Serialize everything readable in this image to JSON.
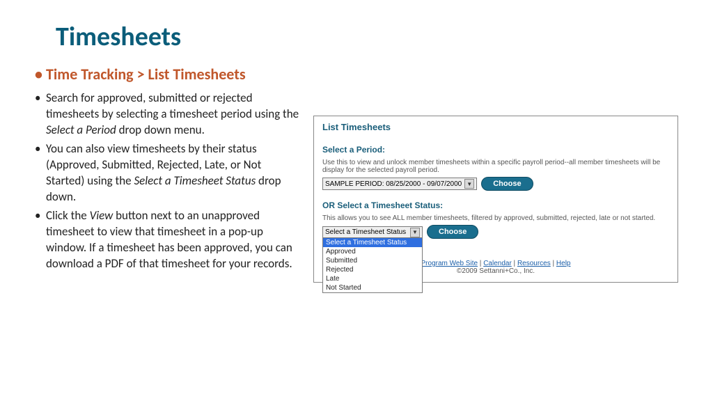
{
  "title": "Timesheets",
  "breadcrumb": "Time Tracking > List Timesheets",
  "bullets": [
    {
      "pre": "Search for approved, submitted or rejected timesheets by selecting a timesheet period using the ",
      "em": "Select a Period",
      "post": " drop down menu."
    },
    {
      "pre": "You can also view timesheets by their status (Approved, Submitted, Rejected, Late, or Not Started) using the ",
      "em": "Select a Timesheet Status",
      "post": " drop down."
    },
    {
      "pre": "Click the ",
      "em": "View",
      "post": " button next to an unapproved timesheet to view that timesheet in a pop-up window. If a timesheet has been approved, you can download a PDF of that timesheet for your records."
    }
  ],
  "panel": {
    "heading": "List Timesheets",
    "period": {
      "label": "Select a Period:",
      "desc": "Use this to view and unlock member timesheets within a specific payroll period--all member timesheets will be display for the selected payroll period.",
      "selected": "SAMPLE PERIOD: 08/25/2000 - 09/07/2000",
      "btn": "Choose"
    },
    "status": {
      "label": "OR Select a Timesheet Status:",
      "desc": "This allows you to see ALL member timesheets, filtered by approved, submitted, rejected, late or not started.",
      "selected": "Select a Timesheet Status",
      "options": [
        "Select a Timesheet Status",
        "Approved",
        "Submitted",
        "Rejected",
        "Late",
        "Not Started"
      ],
      "btn": "Choose"
    },
    "footer": {
      "links": [
        "Program Web Site",
        "Calendar",
        "Resources",
        "Help"
      ],
      "copyright": "©2009 Settanni+Co., Inc."
    }
  }
}
